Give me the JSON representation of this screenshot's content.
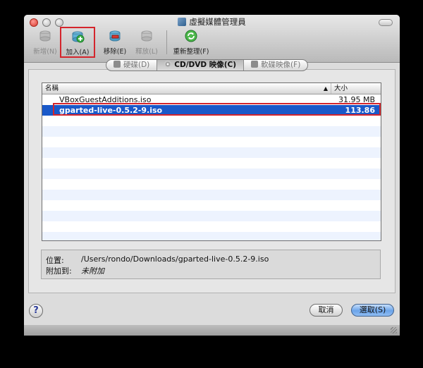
{
  "window": {
    "title": "虛擬媒體管理員"
  },
  "toolbar": {
    "buttons": [
      {
        "label": "新增(N)",
        "icon": "new-disk-icon",
        "enabled": false
      },
      {
        "label": "加入(A)",
        "icon": "add-disk-icon",
        "enabled": true,
        "highlighted": true
      },
      {
        "label": "移除(E)",
        "icon": "remove-disk-icon",
        "enabled": true
      },
      {
        "label": "釋放(L)",
        "icon": "release-disk-icon",
        "enabled": false
      },
      {
        "label": "重新整理(F)",
        "icon": "refresh-icon",
        "enabled": true
      }
    ]
  },
  "tabs": [
    {
      "label": "硬碟(D)",
      "icon": "hard-disk-icon",
      "active": false
    },
    {
      "label": "CD/DVD 映像(C)",
      "icon": "cd-dvd-icon",
      "active": true
    },
    {
      "label": "軟碟映像(F)",
      "icon": "floppy-icon",
      "active": false
    }
  ],
  "table": {
    "columns": {
      "name": "名稱",
      "size": "大小"
    },
    "rows": [
      {
        "name": "VBoxGuestAdditions.iso",
        "size": "31.95 MB",
        "selected": false
      },
      {
        "name": "gparted-live-0.5.2-9.iso",
        "size": "113.86 MB",
        "selected": true
      }
    ]
  },
  "info": {
    "location_label": "位置:",
    "location_value": "/Users/rondo/Downloads/gparted-live-0.5.2-9.iso",
    "attached_label": "附加到:",
    "attached_value": "未附加"
  },
  "footer": {
    "help": "?",
    "cancel": "取消",
    "select": "選取(S)"
  },
  "colors": {
    "selection": "#1a59c9",
    "highlight_box": "#d4252c",
    "primary_button": "#6ba4e9"
  }
}
